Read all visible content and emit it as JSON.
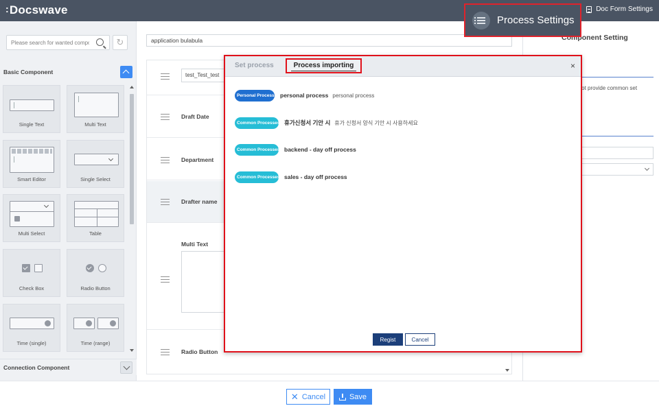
{
  "app": {
    "logo": "Docswave",
    "doc_form_settings": "Doc Form Settings",
    "process_settings": "Process Settings"
  },
  "left": {
    "search_placeholder": "Please search for wanted component",
    "basic_component": "Basic Component",
    "connection_component": "Connection Component",
    "components": [
      {
        "label": "Single Text"
      },
      {
        "label": "Multi Text"
      },
      {
        "label": "Smart Editor"
      },
      {
        "label": "Single Select"
      },
      {
        "label": "Multi Select"
      },
      {
        "label": "Table"
      },
      {
        "label": "Check Box"
      },
      {
        "label": "Radio Button"
      },
      {
        "label": "Time (single)"
      },
      {
        "label": "Time (range)"
      }
    ]
  },
  "form": {
    "title": "application bulabula",
    "rows": [
      {
        "label": "",
        "value": "test_Test_test"
      },
      {
        "label": "Draft Date"
      },
      {
        "label": "Department"
      },
      {
        "label": "Drafter name"
      },
      {
        "label": "Multi Text"
      },
      {
        "label": "Radio Button"
      }
    ]
  },
  "right": {
    "title": "Component Setting",
    "note": "es not provide common set"
  },
  "bottom": {
    "cancel": "Cancel",
    "save": "Save"
  },
  "modal": {
    "tab_set": "Set process",
    "tab_import": "Process importing",
    "close": "×",
    "processes": [
      {
        "badge": "Personal Process",
        "type": "personal",
        "name": "personal process",
        "desc": "personal process"
      },
      {
        "badge": "Common Processes",
        "type": "common",
        "name": "휴가신청서 기안 시",
        "desc": "휴가 신청서 양식 기안 시 사용하세요"
      },
      {
        "badge": "Common Processes",
        "type": "common",
        "name": "backend - day off process",
        "desc": ""
      },
      {
        "badge": "Common Processes",
        "type": "common",
        "name": "sales - day off process",
        "desc": ""
      }
    ],
    "regist": "Regist",
    "cancel": "Cancel"
  },
  "colors": {
    "topbar": "#3b4656",
    "primary": "#2e82f2",
    "highlight": "#e0101a",
    "personal_badge": "#1f6fd0",
    "common_badge": "#26bdd6",
    "regist": "#1c3f7a"
  }
}
